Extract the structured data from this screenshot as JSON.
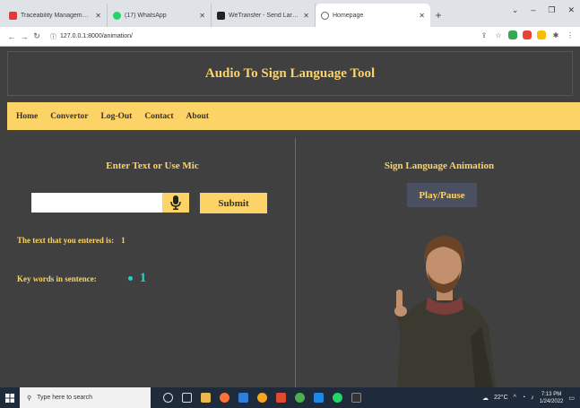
{
  "browser": {
    "tabs": [
      {
        "label": "Traceability Management with l",
        "color": "#e53935"
      },
      {
        "label": "(17) WhatsApp",
        "color": "#25d366"
      },
      {
        "label": "WeTransfer - Send Large Files &",
        "color": "#222222"
      },
      {
        "label": "Homepage",
        "color": "#5f6368"
      }
    ],
    "url": "127.0.0.1:8000/animation/"
  },
  "site": {
    "title": "Audio To Sign Language Tool",
    "nav": [
      "Home",
      "Convertor",
      "Log-Out",
      "Contact",
      "About"
    ],
    "colors": {
      "accent": "#fcd366",
      "background": "#404040",
      "keyword": "#1fd3c6"
    }
  },
  "left": {
    "title": "Enter Text or Use Mic",
    "input_value": "",
    "mic_icon": "microphone-icon",
    "submit_label": "Submit",
    "entered_label": "The text that you entered is:",
    "entered_value": "1",
    "keywords_label": "Key words in sentence:",
    "keywords": [
      "1"
    ]
  },
  "right": {
    "title": "Sign Language Animation",
    "play_label": "Play/Pause"
  },
  "taskbar": {
    "search_placeholder": "Type here to search",
    "weather": "22°C",
    "time": "7:13 PM",
    "date": "1/24/2022"
  }
}
